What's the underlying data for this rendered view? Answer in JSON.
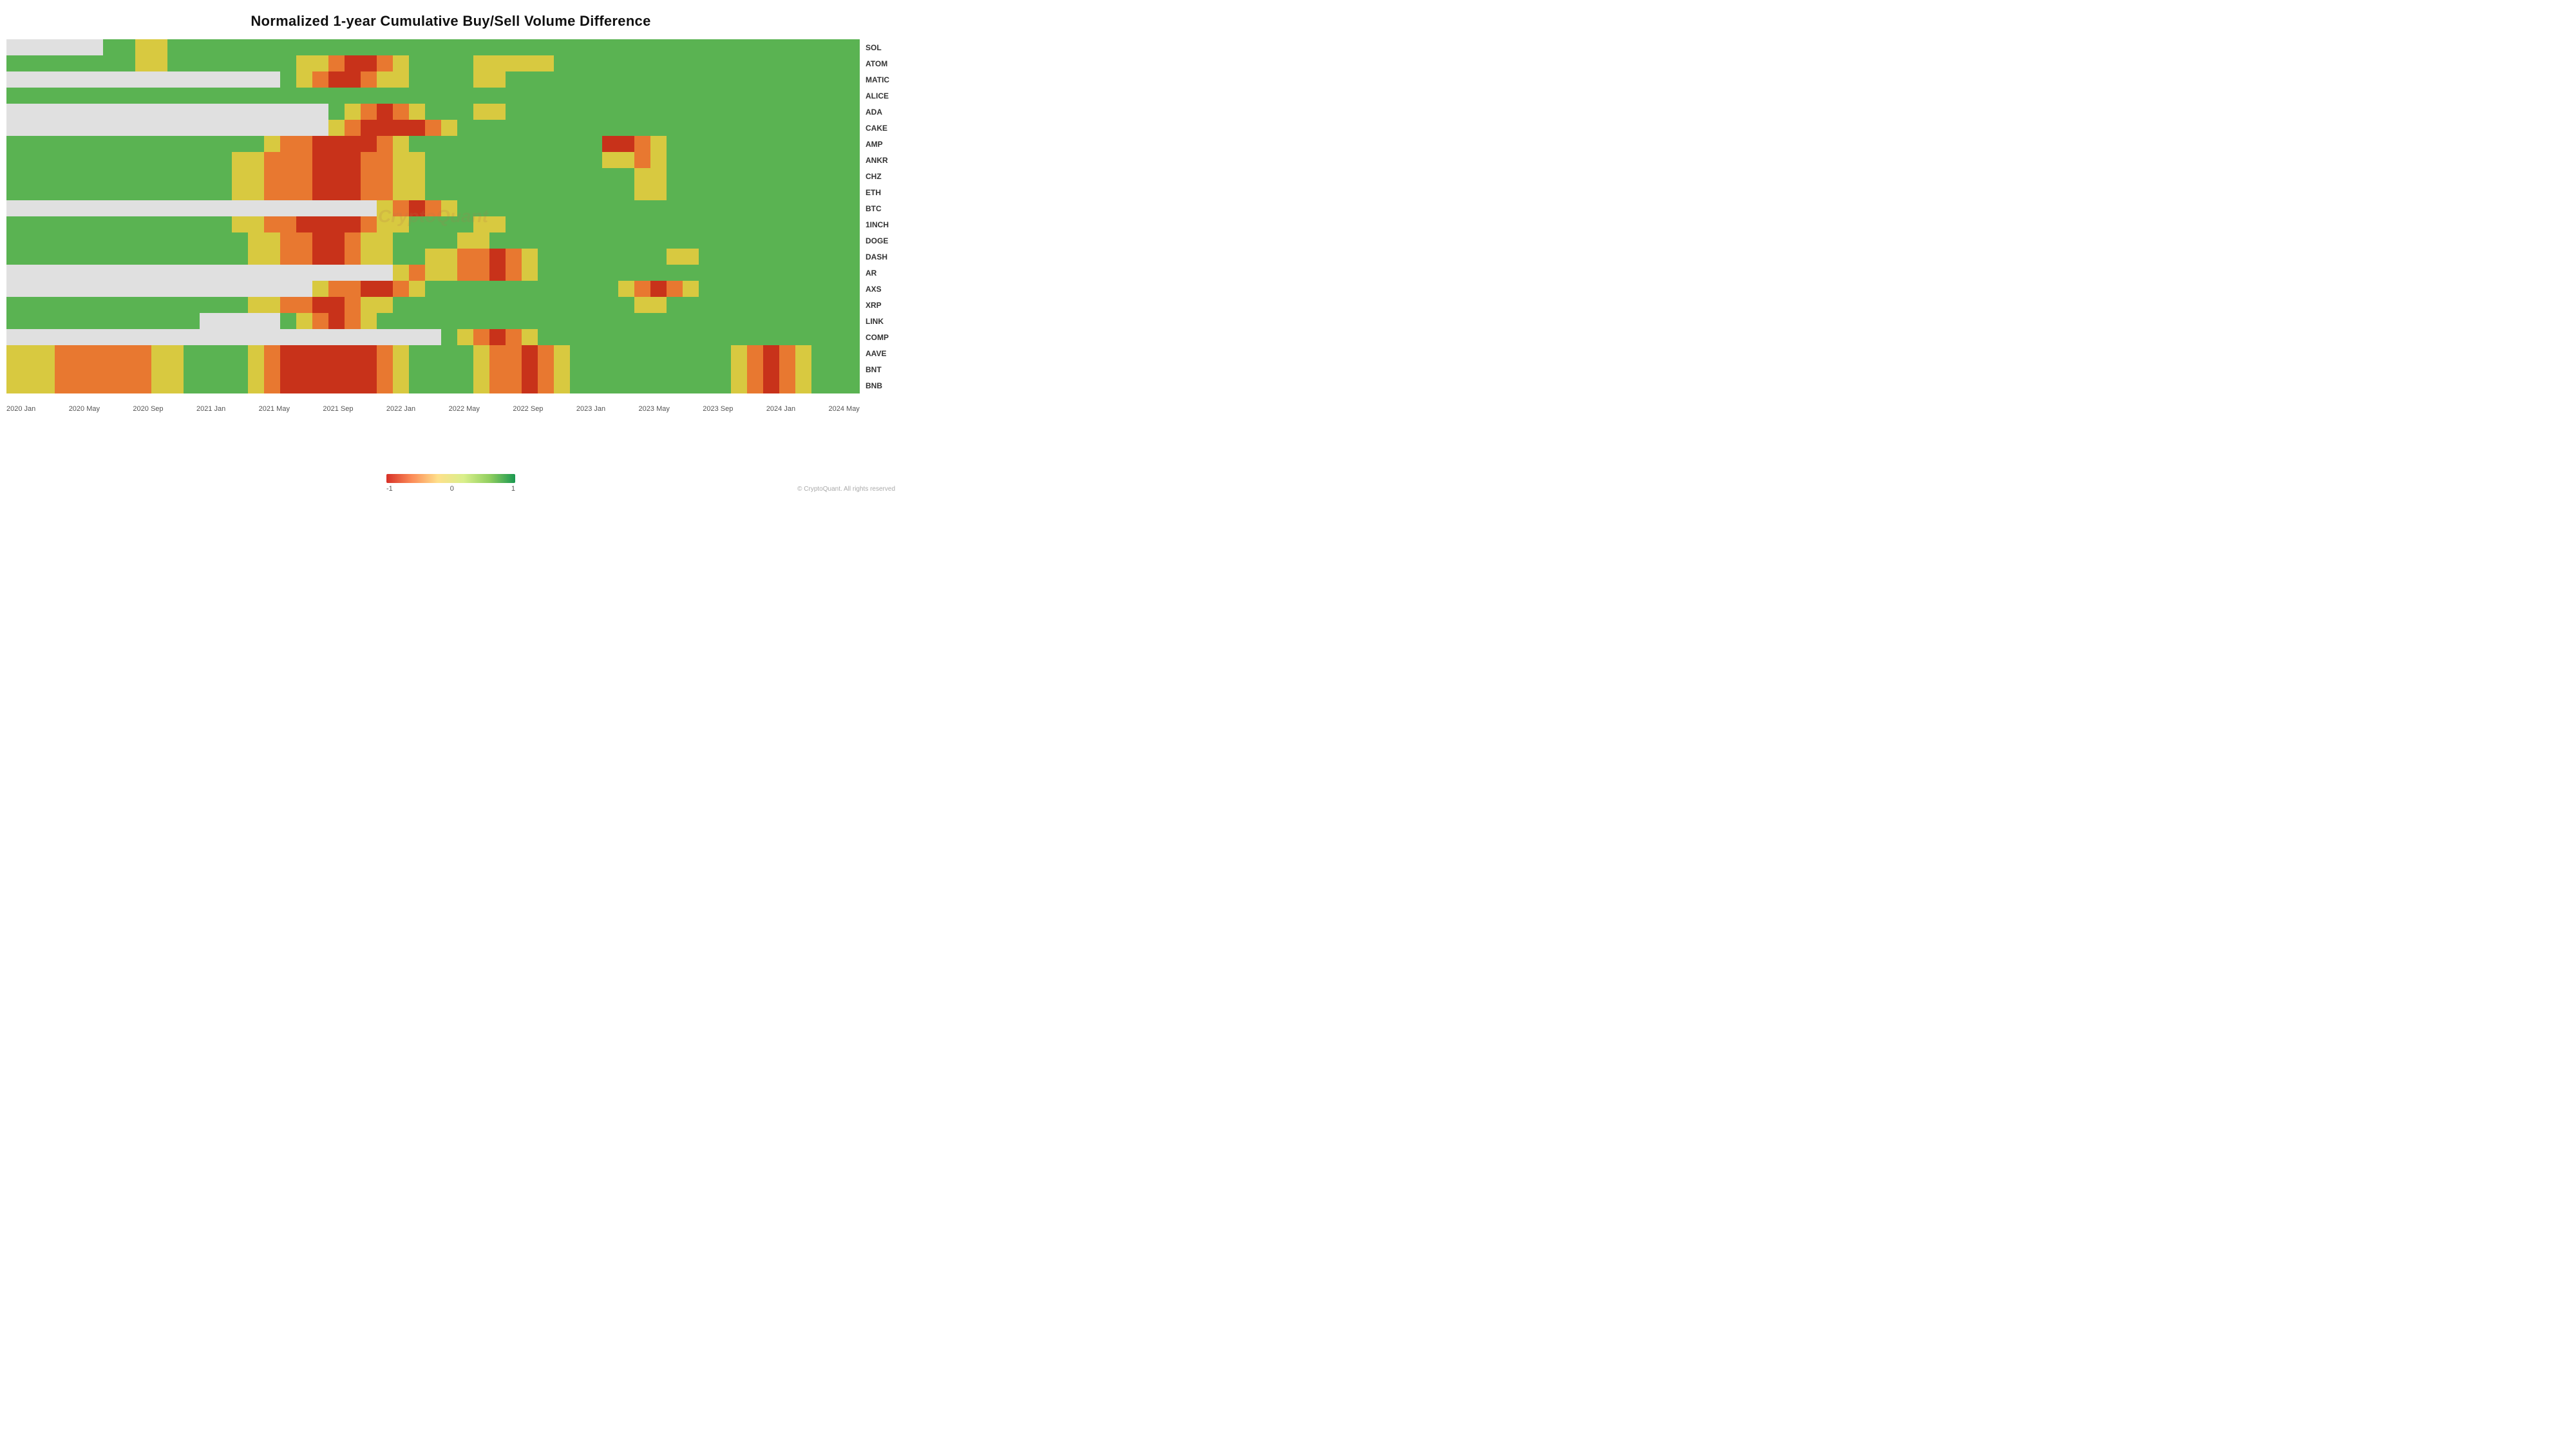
{
  "title": "Normalized 1-year Cumulative Buy/Sell Volume Difference",
  "watermark": "CryptoQuant",
  "copyright": "© CryptoQuant. All rights reserved",
  "yLabels": [
    "SOL",
    "ATOM",
    "MATIC",
    "ALICE",
    "ADA",
    "CAKE",
    "AMP",
    "ANKR",
    "CHZ",
    "ETH",
    "BTC",
    "1INCH",
    "DOGE",
    "DASH",
    "AR",
    "AXS",
    "XRP",
    "LINK",
    "COMP",
    "AAVE",
    "BNT",
    "BNB"
  ],
  "xLabels": [
    "2020 Jan",
    "2020 May",
    "2020 Sep",
    "2021 Jan",
    "2021 May",
    "2021 Sep",
    "2022 Jan",
    "2022 May",
    "2022 Sep",
    "2023 Jan",
    "2023 May",
    "2023 Sep",
    "2024 Jan",
    "2024 May"
  ],
  "legend": {
    "min": "-1",
    "mid": "0",
    "max": "1"
  },
  "heatmapData": [
    [
      "gray",
      "gray",
      "gray",
      "gray",
      "gray",
      "gray",
      "green",
      "green",
      "yellow",
      "yellow",
      "green",
      "green",
      "green",
      "green",
      "green",
      "green",
      "green",
      "green",
      "green",
      "green",
      "green",
      "green",
      "green",
      "green",
      "green",
      "green",
      "green",
      "green",
      "green",
      "green",
      "green",
      "green",
      "green",
      "green",
      "green",
      "green",
      "green",
      "green",
      "green",
      "green",
      "green",
      "green",
      "green",
      "green",
      "green",
      "green",
      "green",
      "green",
      "green",
      "green",
      "green",
      "green",
      "green"
    ],
    [
      "green",
      "green",
      "green",
      "green",
      "green",
      "green",
      "green",
      "green",
      "yellow",
      "yellow",
      "green",
      "green",
      "green",
      "green",
      "green",
      "green",
      "green",
      "green",
      "yellow",
      "yellow",
      "orange",
      "red",
      "red",
      "orange",
      "yellow",
      "green",
      "green",
      "green",
      "green",
      "yellow",
      "yellow",
      "yellow",
      "yellow",
      "yellow",
      "green",
      "green",
      "green",
      "green",
      "green",
      "green",
      "green",
      "green",
      "green",
      "green",
      "green",
      "green",
      "green",
      "green",
      "green",
      "green",
      "green",
      "green",
      "green"
    ],
    [
      "gray",
      "gray",
      "gray",
      "gray",
      "gray",
      "gray",
      "gray",
      "gray",
      "gray",
      "gray",
      "gray",
      "gray",
      "gray",
      "gray",
      "gray",
      "gray",
      "gray",
      "green",
      "yellow",
      "orange",
      "red",
      "red",
      "orange",
      "yellow",
      "yellow",
      "green",
      "green",
      "green",
      "green",
      "yellow",
      "yellow",
      "green",
      "green",
      "green",
      "green",
      "green",
      "green",
      "green",
      "green",
      "green",
      "green",
      "green",
      "green",
      "green",
      "green",
      "green",
      "green",
      "green",
      "green",
      "green",
      "green",
      "green",
      "green"
    ],
    [
      "green",
      "green",
      "green",
      "green",
      "green",
      "green",
      "green",
      "green",
      "green",
      "green",
      "green",
      "green",
      "green",
      "green",
      "green",
      "green",
      "green",
      "green",
      "green",
      "green",
      "green",
      "green",
      "green",
      "green",
      "green",
      "green",
      "green",
      "green",
      "green",
      "green",
      "green",
      "green",
      "green",
      "green",
      "green",
      "green",
      "green",
      "green",
      "green",
      "green",
      "green",
      "green",
      "green",
      "green",
      "green",
      "green",
      "green",
      "green",
      "green",
      "green",
      "green",
      "green",
      "green"
    ],
    [
      "gray",
      "gray",
      "gray",
      "gray",
      "gray",
      "gray",
      "gray",
      "gray",
      "gray",
      "gray",
      "gray",
      "gray",
      "gray",
      "gray",
      "gray",
      "gray",
      "gray",
      "gray",
      "gray",
      "gray",
      "green",
      "yellow",
      "orange",
      "red",
      "orange",
      "yellow",
      "green",
      "green",
      "green",
      "yellow",
      "yellow",
      "green",
      "green",
      "green",
      "green",
      "green",
      "green",
      "green",
      "green",
      "green",
      "green",
      "green",
      "green",
      "green",
      "green",
      "green",
      "green",
      "green",
      "green",
      "green",
      "green",
      "green",
      "green"
    ],
    [
      "gray",
      "gray",
      "gray",
      "gray",
      "gray",
      "gray",
      "gray",
      "gray",
      "gray",
      "gray",
      "gray",
      "gray",
      "gray",
      "gray",
      "gray",
      "gray",
      "gray",
      "gray",
      "gray",
      "gray",
      "yellow",
      "orange",
      "red",
      "red",
      "red",
      "red",
      "orange",
      "yellow",
      "green",
      "green",
      "green",
      "green",
      "green",
      "green",
      "green",
      "green",
      "green",
      "green",
      "green",
      "green",
      "green",
      "green",
      "green",
      "green",
      "green",
      "green",
      "green",
      "green",
      "green",
      "green",
      "green",
      "green",
      "green"
    ],
    [
      "green",
      "green",
      "green",
      "green",
      "green",
      "green",
      "green",
      "green",
      "green",
      "green",
      "green",
      "green",
      "green",
      "green",
      "green",
      "green",
      "yellow",
      "orange",
      "orange",
      "red",
      "red",
      "red",
      "red",
      "orange",
      "yellow",
      "green",
      "green",
      "green",
      "green",
      "green",
      "green",
      "green",
      "green",
      "green",
      "green",
      "green",
      "green",
      "red",
      "red",
      "orange",
      "yellow",
      "green",
      "green",
      "green",
      "green",
      "green",
      "green",
      "green",
      "green",
      "green",
      "green",
      "green",
      "green"
    ],
    [
      "green",
      "green",
      "green",
      "green",
      "green",
      "green",
      "green",
      "green",
      "green",
      "green",
      "green",
      "green",
      "green",
      "green",
      "yellow",
      "yellow",
      "orange",
      "orange",
      "orange",
      "red",
      "red",
      "red",
      "orange",
      "orange",
      "yellow",
      "yellow",
      "green",
      "green",
      "green",
      "green",
      "green",
      "green",
      "green",
      "green",
      "green",
      "green",
      "green",
      "yellow",
      "yellow",
      "orange",
      "yellow",
      "green",
      "green",
      "green",
      "green",
      "green",
      "green",
      "green",
      "green",
      "green",
      "green",
      "green",
      "green"
    ],
    [
      "green",
      "green",
      "green",
      "green",
      "green",
      "green",
      "green",
      "green",
      "green",
      "green",
      "green",
      "green",
      "green",
      "green",
      "yellow",
      "yellow",
      "orange",
      "orange",
      "orange",
      "red",
      "red",
      "red",
      "orange",
      "orange",
      "yellow",
      "yellow",
      "green",
      "green",
      "green",
      "green",
      "green",
      "green",
      "green",
      "green",
      "green",
      "green",
      "green",
      "green",
      "green",
      "yellow",
      "yellow",
      "green",
      "green",
      "green",
      "green",
      "green",
      "green",
      "green",
      "green",
      "green",
      "green",
      "green",
      "green"
    ],
    [
      "green",
      "green",
      "green",
      "green",
      "green",
      "green",
      "green",
      "green",
      "green",
      "green",
      "green",
      "green",
      "green",
      "green",
      "yellow",
      "yellow",
      "orange",
      "orange",
      "orange",
      "red",
      "red",
      "red",
      "orange",
      "orange",
      "yellow",
      "yellow",
      "green",
      "green",
      "green",
      "green",
      "green",
      "green",
      "green",
      "green",
      "green",
      "green",
      "green",
      "green",
      "green",
      "yellow",
      "yellow",
      "green",
      "green",
      "green",
      "green",
      "green",
      "green",
      "green",
      "green",
      "green",
      "green",
      "green",
      "green"
    ],
    [
      "gray",
      "gray",
      "gray",
      "gray",
      "gray",
      "gray",
      "gray",
      "gray",
      "gray",
      "gray",
      "gray",
      "gray",
      "gray",
      "gray",
      "gray",
      "gray",
      "gray",
      "gray",
      "gray",
      "gray",
      "gray",
      "gray",
      "gray",
      "yellow",
      "orange",
      "red",
      "orange",
      "yellow",
      "green",
      "green",
      "green",
      "green",
      "green",
      "green",
      "green",
      "green",
      "green",
      "green",
      "green",
      "green",
      "green",
      "green",
      "green",
      "green",
      "green",
      "green",
      "green",
      "green",
      "green",
      "green",
      "green",
      "green",
      "green"
    ],
    [
      "green",
      "green",
      "green",
      "green",
      "green",
      "green",
      "green",
      "green",
      "green",
      "green",
      "green",
      "green",
      "green",
      "green",
      "yellow",
      "yellow",
      "orange",
      "orange",
      "red",
      "red",
      "red",
      "red",
      "orange",
      "yellow",
      "yellow",
      "green",
      "green",
      "green",
      "green",
      "yellow",
      "yellow",
      "green",
      "green",
      "green",
      "green",
      "green",
      "green",
      "green",
      "green",
      "green",
      "green",
      "green",
      "green",
      "green",
      "green",
      "green",
      "green",
      "green",
      "green",
      "green",
      "green",
      "green",
      "green"
    ],
    [
      "green",
      "green",
      "green",
      "green",
      "green",
      "green",
      "green",
      "green",
      "green",
      "green",
      "green",
      "green",
      "green",
      "green",
      "green",
      "yellow",
      "yellow",
      "orange",
      "orange",
      "red",
      "red",
      "orange",
      "yellow",
      "yellow",
      "green",
      "green",
      "green",
      "green",
      "yellow",
      "yellow",
      "green",
      "green",
      "green",
      "green",
      "green",
      "green",
      "green",
      "green",
      "green",
      "green",
      "green",
      "green",
      "green",
      "green",
      "green",
      "green",
      "green",
      "green",
      "green",
      "green",
      "green",
      "green",
      "green"
    ],
    [
      "green",
      "green",
      "green",
      "green",
      "green",
      "green",
      "green",
      "green",
      "green",
      "green",
      "green",
      "green",
      "green",
      "green",
      "green",
      "yellow",
      "yellow",
      "orange",
      "orange",
      "red",
      "red",
      "orange",
      "yellow",
      "yellow",
      "green",
      "green",
      "yellow",
      "yellow",
      "orange",
      "orange",
      "red",
      "orange",
      "yellow",
      "green",
      "green",
      "green",
      "green",
      "green",
      "green",
      "green",
      "green",
      "yellow",
      "yellow",
      "green",
      "green",
      "green",
      "green",
      "green",
      "green",
      "green",
      "green",
      "green",
      "green"
    ],
    [
      "gray",
      "gray",
      "gray",
      "gray",
      "gray",
      "gray",
      "gray",
      "gray",
      "gray",
      "gray",
      "gray",
      "gray",
      "gray",
      "gray",
      "gray",
      "gray",
      "gray",
      "gray",
      "gray",
      "gray",
      "gray",
      "gray",
      "gray",
      "gray",
      "yellow",
      "orange",
      "yellow",
      "yellow",
      "orange",
      "orange",
      "red",
      "orange",
      "yellow",
      "green",
      "green",
      "green",
      "green",
      "green",
      "green",
      "green",
      "green",
      "green",
      "green",
      "green",
      "green",
      "green",
      "green",
      "green",
      "green",
      "green",
      "green",
      "green",
      "green"
    ],
    [
      "gray",
      "gray",
      "gray",
      "gray",
      "gray",
      "gray",
      "gray",
      "gray",
      "gray",
      "gray",
      "gray",
      "gray",
      "gray",
      "gray",
      "gray",
      "gray",
      "gray",
      "gray",
      "gray",
      "yellow",
      "orange",
      "orange",
      "red",
      "red",
      "orange",
      "yellow",
      "green",
      "green",
      "green",
      "green",
      "green",
      "green",
      "green",
      "green",
      "green",
      "green",
      "green",
      "green",
      "yellow",
      "orange",
      "red",
      "orange",
      "yellow",
      "green",
      "green",
      "green",
      "green",
      "green",
      "green",
      "green",
      "green",
      "green",
      "green"
    ],
    [
      "green",
      "green",
      "green",
      "green",
      "green",
      "green",
      "green",
      "green",
      "green",
      "green",
      "green",
      "green",
      "green",
      "green",
      "green",
      "yellow",
      "yellow",
      "orange",
      "orange",
      "red",
      "red",
      "orange",
      "yellow",
      "yellow",
      "green",
      "green",
      "green",
      "green",
      "green",
      "green",
      "green",
      "green",
      "green",
      "green",
      "green",
      "green",
      "green",
      "green",
      "green",
      "yellow",
      "yellow",
      "green",
      "green",
      "green",
      "green",
      "green",
      "green",
      "green",
      "green",
      "green",
      "green",
      "green",
      "green"
    ],
    [
      "green",
      "green",
      "green",
      "green",
      "green",
      "green",
      "green",
      "green",
      "green",
      "green",
      "green",
      "green",
      "gray",
      "gray",
      "gray",
      "gray",
      "gray",
      "green",
      "yellow",
      "orange",
      "red",
      "orange",
      "yellow",
      "green",
      "green",
      "green",
      "green",
      "green",
      "green",
      "green",
      "green",
      "green",
      "green",
      "green",
      "green",
      "green",
      "green",
      "green",
      "green",
      "green",
      "green",
      "green",
      "green",
      "green",
      "green",
      "green",
      "green",
      "green",
      "green",
      "green",
      "green",
      "green",
      "green"
    ],
    [
      "gray",
      "gray",
      "gray",
      "gray",
      "gray",
      "gray",
      "gray",
      "gray",
      "gray",
      "gray",
      "gray",
      "gray",
      "gray",
      "gray",
      "gray",
      "gray",
      "gray",
      "gray",
      "gray",
      "gray",
      "gray",
      "gray",
      "gray",
      "gray",
      "gray",
      "gray",
      "gray",
      "green",
      "yellow",
      "orange",
      "red",
      "orange",
      "yellow",
      "green",
      "green",
      "green",
      "green",
      "green",
      "green",
      "green",
      "green",
      "green",
      "green",
      "green",
      "green",
      "green",
      "green",
      "green",
      "green",
      "green",
      "green",
      "green",
      "green"
    ],
    [
      "yellow",
      "yellow",
      "yellow",
      "orange",
      "orange",
      "orange",
      "orange",
      "orange",
      "orange",
      "yellow",
      "yellow",
      "green",
      "green",
      "green",
      "green",
      "yellow",
      "orange",
      "red",
      "red",
      "red",
      "red",
      "red",
      "red",
      "orange",
      "yellow",
      "green",
      "green",
      "green",
      "green",
      "yellow",
      "orange",
      "orange",
      "red",
      "orange",
      "yellow",
      "green",
      "green",
      "green",
      "green",
      "green",
      "green",
      "green",
      "green",
      "green",
      "green",
      "yellow",
      "orange",
      "red",
      "orange",
      "yellow",
      "green",
      "green",
      "green"
    ],
    [
      "yellow",
      "yellow",
      "yellow",
      "orange",
      "orange",
      "orange",
      "orange",
      "orange",
      "orange",
      "yellow",
      "yellow",
      "green",
      "green",
      "green",
      "green",
      "yellow",
      "orange",
      "red",
      "red",
      "red",
      "red",
      "red",
      "red",
      "orange",
      "yellow",
      "green",
      "green",
      "green",
      "green",
      "yellow",
      "orange",
      "orange",
      "red",
      "orange",
      "yellow",
      "green",
      "green",
      "green",
      "green",
      "green",
      "green",
      "green",
      "green",
      "green",
      "green",
      "yellow",
      "orange",
      "red",
      "orange",
      "yellow",
      "green",
      "green",
      "green"
    ],
    [
      "yellow",
      "yellow",
      "yellow",
      "orange",
      "orange",
      "orange",
      "orange",
      "orange",
      "orange",
      "yellow",
      "yellow",
      "green",
      "green",
      "green",
      "green",
      "yellow",
      "orange",
      "red",
      "red",
      "red",
      "red",
      "red",
      "red",
      "orange",
      "yellow",
      "green",
      "green",
      "green",
      "green",
      "yellow",
      "orange",
      "orange",
      "red",
      "orange",
      "yellow",
      "green",
      "green",
      "green",
      "green",
      "green",
      "green",
      "green",
      "green",
      "green",
      "green",
      "yellow",
      "orange",
      "red",
      "orange",
      "yellow",
      "green",
      "green",
      "green"
    ]
  ]
}
